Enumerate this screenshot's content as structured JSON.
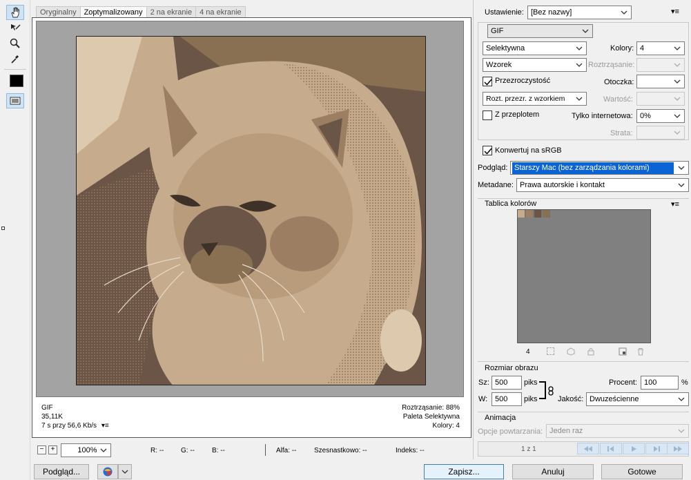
{
  "tabs": [
    "Oryginalny",
    "Zoptymalizowany",
    "2 na ekranie",
    "4 na ekranie"
  ],
  "preview_info": {
    "format": "GIF",
    "size": "35,11K",
    "time": "7 s przy 56,6 Kb/s",
    "dither": "Roztrząsanie: 88%",
    "palette": "Paleta Selektywna",
    "colors": "Kolory: 4"
  },
  "status": {
    "zoom": "100%",
    "r": "R: --",
    "g": "G: --",
    "b": "B: --",
    "alpha": "Alfa: --",
    "hex": "Szesnastkowo: --",
    "index": "Indeks: --"
  },
  "buttons": {
    "preview": "Podgląd...",
    "save": "Zapisz...",
    "cancel": "Anuluj",
    "done": "Gotowe"
  },
  "settings": {
    "preset_label": "Ustawienie:",
    "preset_value": "[Bez nazwy]",
    "format_value": "GIF",
    "reduction_value": "Selektywna",
    "colors_label": "Kolory:",
    "colors_value": "4",
    "dither_algo_value": "Wzorek",
    "dither_label": "Roztrząsanie:",
    "transparency_label": "Przezroczystość",
    "matte_label": "Otoczka:",
    "transparency_dither_value": "Rozt. przezr. z wzorkiem",
    "amount_label": "Wartość:",
    "interlaced_label": "Z przeplotem",
    "websnap_label": "Tylko internetowa:",
    "websnap_value": "0%",
    "lossy_label": "Strata:",
    "convert_srgb_label": "Konwertuj na sRGB",
    "preview_label": "Podgląd:",
    "preview_value": "Starszy Mac (bez zarządzania kolorami)",
    "metadata_label": "Metadane:",
    "metadata_value": "Prawa autorskie i kontakt"
  },
  "color_table": {
    "title": "Tablica kolorów",
    "count": "4",
    "colors": [
      "#c6ac8c",
      "#9c7f62",
      "#6a5547",
      "#8a7052"
    ]
  },
  "image_size": {
    "title": "Rozmiar obrazu",
    "width_label": "Sz:",
    "width_value": "500",
    "height_label": "W:",
    "height_value": "500",
    "unit": "piks",
    "percent_label": "Procent:",
    "percent_value": "100",
    "percent_sign": "%",
    "quality_label": "Jakość:",
    "quality_value": "Dwuześcienne"
  },
  "animation": {
    "title": "Animacja",
    "loop_label": "Opcje powtarzania:",
    "loop_value": "Jeden raz",
    "frame_counter": "1 z 1"
  },
  "colors": {
    "selection": "#0a64d6",
    "canvas": "#a3a3a3",
    "color_table_bg": "#808080"
  }
}
